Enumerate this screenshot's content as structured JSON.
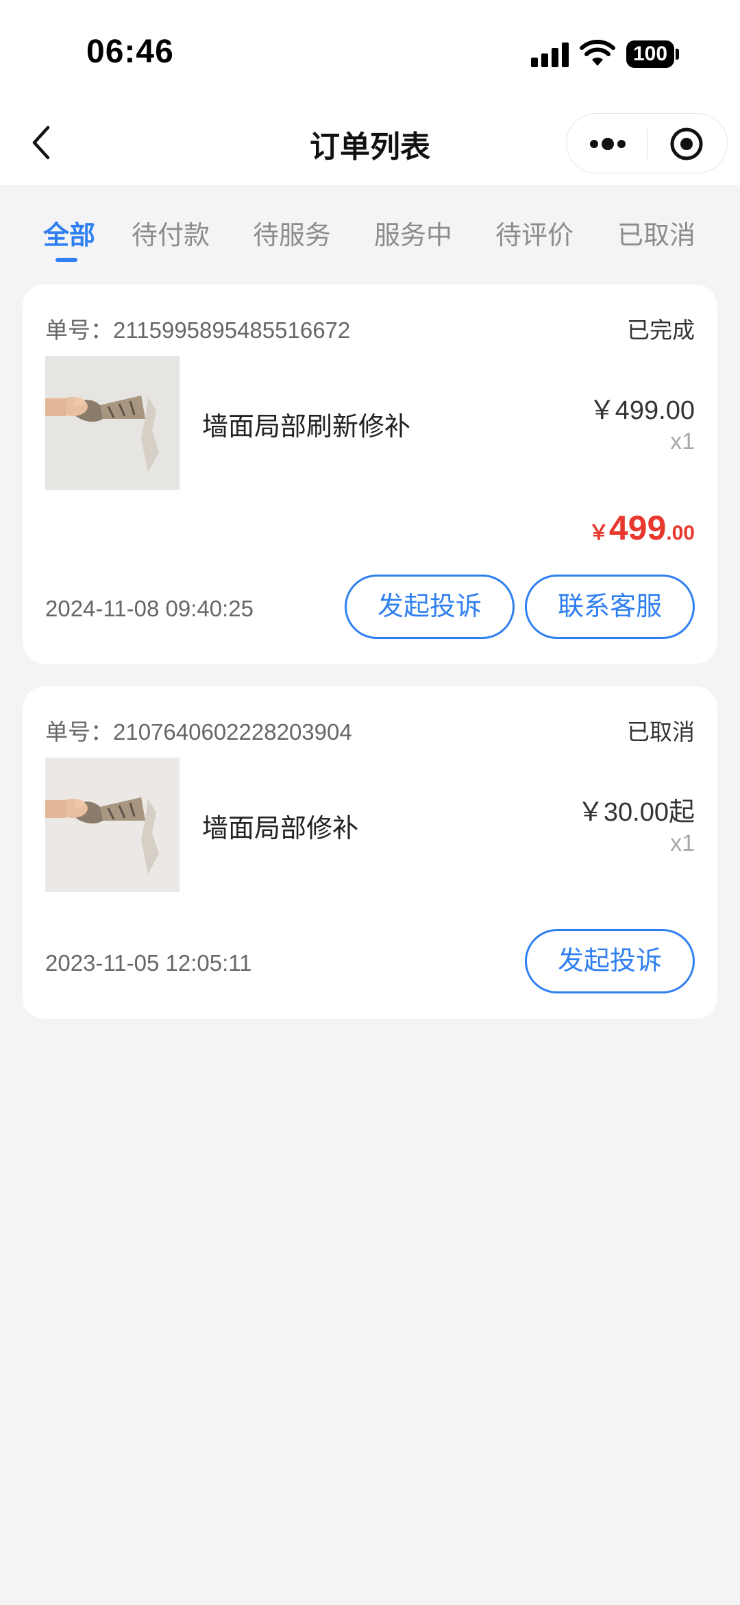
{
  "status_bar": {
    "time": "06:46",
    "battery": "100"
  },
  "nav": {
    "title": "订单列表"
  },
  "tabs": [
    {
      "label": "全部",
      "active": true
    },
    {
      "label": "待付款",
      "active": false
    },
    {
      "label": "待服务",
      "active": false
    },
    {
      "label": "服务中",
      "active": false
    },
    {
      "label": "待评价",
      "active": false
    },
    {
      "label": "已取消",
      "active": false
    }
  ],
  "orders": [
    {
      "order_no": "单号：2115995895485516672",
      "status": "已完成",
      "item_name": "墙面局部刷新修补",
      "price": "￥499.00",
      "qty": "x1",
      "total": {
        "currency": "￥",
        "integer": "499",
        "decimal": ".00"
      },
      "time": "2024-11-08 09:40:25",
      "buttons": [
        "发起投诉",
        "联系客服"
      ]
    },
    {
      "order_no": "单号：2107640602228203904",
      "status": "已取消",
      "item_name": "墙面局部修补",
      "price": "￥30.00起",
      "qty": "x1",
      "time": "2023-11-05 12:05:11",
      "buttons": [
        "发起投诉"
      ]
    }
  ],
  "colors": {
    "accent": "#2f7ff0",
    "price_red": "#e8372c",
    "background": "#f4f4f6"
  },
  "icons": [
    "back-chevron-icon",
    "more-dots-icon",
    "target-circle-icon",
    "signal-icon",
    "wifi-icon",
    "battery-icon"
  ]
}
